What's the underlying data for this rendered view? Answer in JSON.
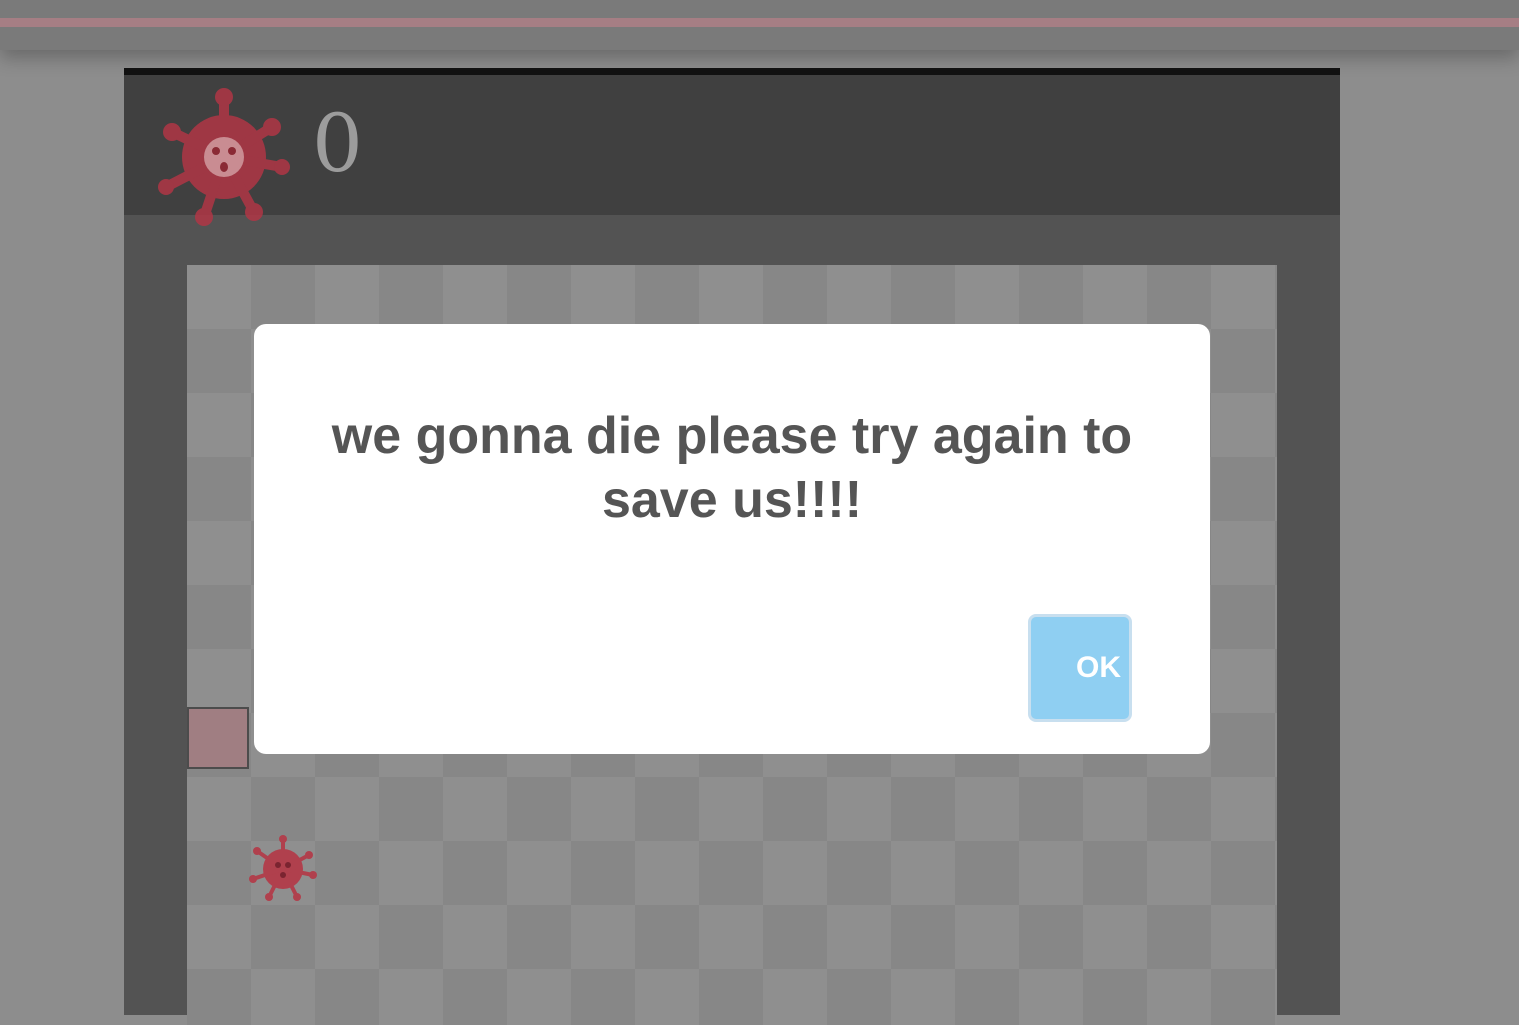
{
  "score": {
    "value": "0",
    "icon": "virus-icon"
  },
  "dialog": {
    "message": "we gonna die please try again to save us!!!!",
    "ok_label": "OK"
  },
  "colors": {
    "virus": "#c0404f",
    "ok_button": "#8fcff2",
    "snake": "#a07e82"
  }
}
